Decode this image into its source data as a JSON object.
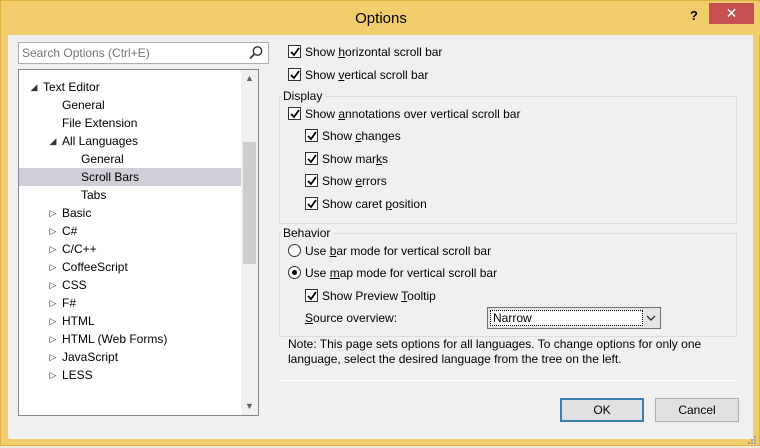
{
  "window": {
    "title": "Options",
    "help_label": "?",
    "close_label": "✕"
  },
  "search": {
    "placeholder": "Search Options (Ctrl+E)",
    "icon": "search-icon"
  },
  "tree": {
    "items": [
      {
        "label": "Text Editor",
        "level": 1,
        "arrow": "expanded"
      },
      {
        "label": "General",
        "level": 2,
        "arrow": "none"
      },
      {
        "label": "File Extension",
        "level": 2,
        "arrow": "none"
      },
      {
        "label": "All Languages",
        "level": 2,
        "arrow": "expanded"
      },
      {
        "label": "General",
        "level": 3,
        "arrow": "none"
      },
      {
        "label": "Scroll Bars",
        "level": 3,
        "arrow": "none",
        "selected": true
      },
      {
        "label": "Tabs",
        "level": 3,
        "arrow": "none"
      },
      {
        "label": "Basic",
        "level": 2,
        "arrow": "collapsed"
      },
      {
        "label": "C#",
        "level": 2,
        "arrow": "collapsed"
      },
      {
        "label": "C/C++",
        "level": 2,
        "arrow": "collapsed"
      },
      {
        "label": "CoffeeScript",
        "level": 2,
        "arrow": "collapsed"
      },
      {
        "label": "CSS",
        "level": 2,
        "arrow": "collapsed"
      },
      {
        "label": "F#",
        "level": 2,
        "arrow": "collapsed"
      },
      {
        "label": "HTML",
        "level": 2,
        "arrow": "collapsed"
      },
      {
        "label": "HTML (Web Forms)",
        "level": 2,
        "arrow": "collapsed"
      },
      {
        "label": "JavaScript",
        "level": 2,
        "arrow": "collapsed"
      },
      {
        "label": "LESS",
        "level": 2,
        "arrow": "collapsed"
      }
    ]
  },
  "options": {
    "show_horizontal": {
      "pre": "Show ",
      "key": "h",
      "post": "orizontal scroll bar",
      "checked": true
    },
    "show_vertical": {
      "pre": "Show ",
      "key": "v",
      "post": "ertical scroll bar",
      "checked": true
    }
  },
  "display": {
    "title": "Display",
    "show_annotations": {
      "pre": "Show ",
      "key": "a",
      "post": "nnotations over vertical scroll bar",
      "checked": true
    },
    "show_changes": {
      "pre": "Show ",
      "key": "c",
      "post": "hanges",
      "checked": true
    },
    "show_marks": {
      "pre": "Show mar",
      "key": "k",
      "post": "s",
      "checked": true
    },
    "show_errors": {
      "pre": "Show ",
      "key": "e",
      "post": "rrors",
      "checked": true
    },
    "show_caret": {
      "pre": "Show caret ",
      "key": "p",
      "post": "osition",
      "checked": true
    }
  },
  "behavior": {
    "title": "Behavior",
    "bar_mode": {
      "pre": "Use ",
      "key": "b",
      "post": "ar mode for vertical scroll bar",
      "selected": false
    },
    "map_mode": {
      "pre": "Use ",
      "key": "m",
      "post": "ap mode for vertical scroll bar",
      "selected": true
    },
    "preview_tooltip": {
      "pre": "Show Preview ",
      "key": "T",
      "post": "ooltip",
      "checked": true
    },
    "source_overview": {
      "pre": "",
      "key": "S",
      "post": "ource overview:",
      "value": "Narrow"
    }
  },
  "note": "Note: This page sets options for all languages. To change options for only one language, select the desired language from the tree on the left.",
  "buttons": {
    "ok": "OK",
    "cancel": "Cancel"
  }
}
